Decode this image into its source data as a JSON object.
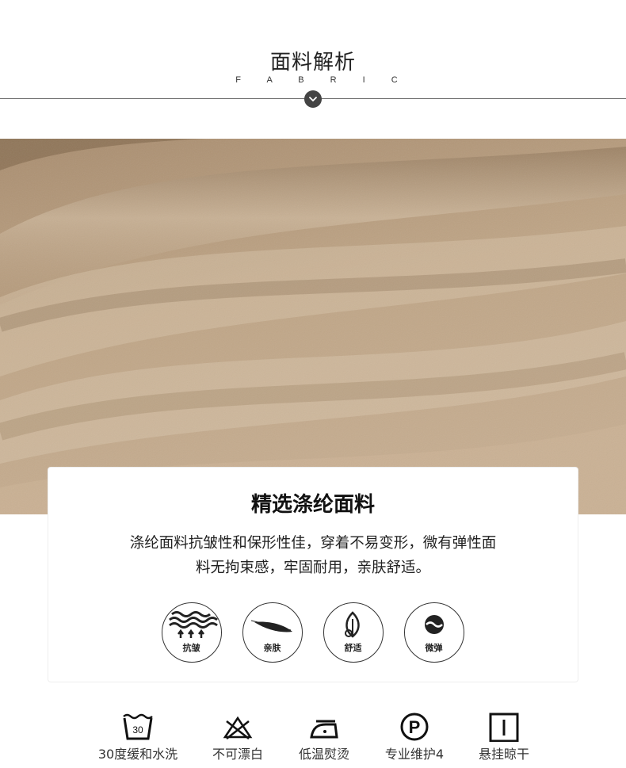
{
  "header": {
    "title": "面料解析",
    "subtitle": "F A B R I C"
  },
  "icons": {
    "scroll": "chevron-down-icon"
  },
  "colors": {
    "fabric": "#b99f82",
    "fabric_light": "#d2bda3",
    "fabric_dark": "#8f7558",
    "text": "#222222"
  },
  "card": {
    "title": "精选涤纶面料",
    "description_line1": "涤纶面料抗皱性和保形性佳，穿着不易变形，微有弹性面",
    "description_line2": "料无拘束感，牢固耐用，亲肤舒适。",
    "features": [
      {
        "label": "抗皱",
        "icon": "wave-arrows-icon"
      },
      {
        "label": "亲肤",
        "icon": "feather-icon"
      },
      {
        "label": "舒适",
        "icon": "leaf-drop-icon"
      },
      {
        "label": "微弹",
        "icon": "elastic-circle-icon"
      }
    ]
  },
  "care": [
    {
      "label": "30度缓和水洗",
      "icon": "wash-30-icon",
      "badge": "30"
    },
    {
      "label": "不可漂白",
      "icon": "no-bleach-icon"
    },
    {
      "label": "低温熨烫",
      "icon": "iron-low-icon"
    },
    {
      "label": "专业维护4",
      "icon": "dry-clean-p-icon",
      "badge": "P"
    },
    {
      "label": "悬挂晾干",
      "icon": "hang-dry-icon"
    }
  ]
}
